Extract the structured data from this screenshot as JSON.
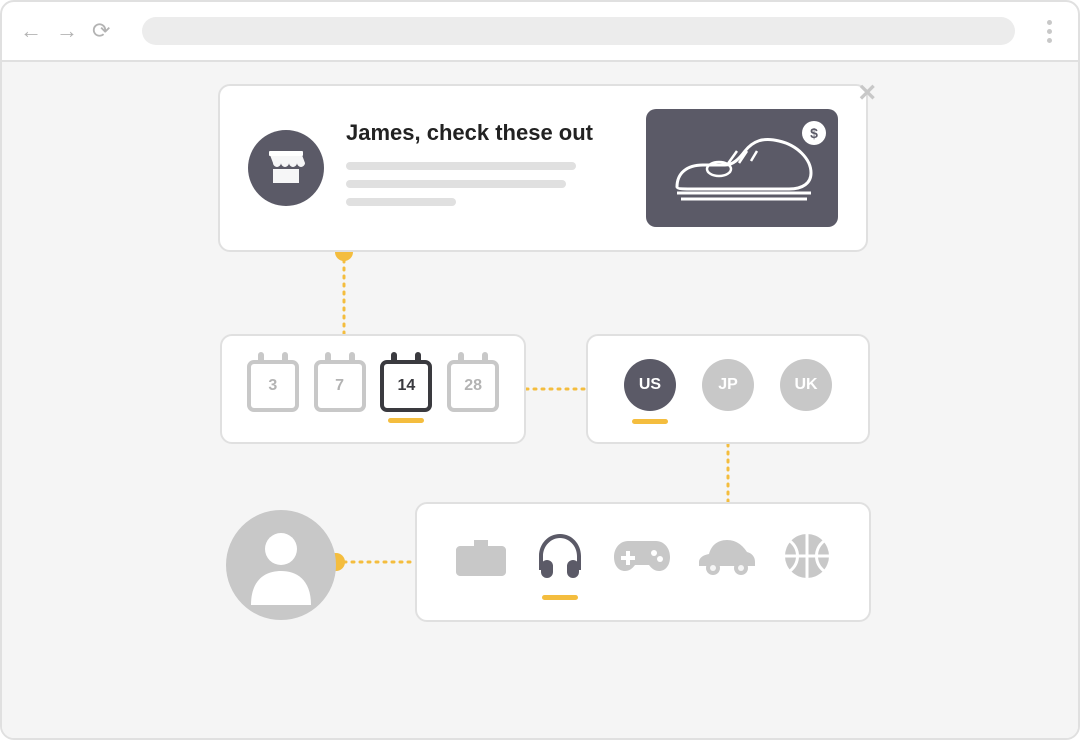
{
  "ad": {
    "headline": "James, check these out",
    "price_symbol": "$"
  },
  "days": [
    {
      "label": "3",
      "active": false
    },
    {
      "label": "7",
      "active": false
    },
    {
      "label": "14",
      "active": true
    },
    {
      "label": "28",
      "active": false
    }
  ],
  "regions": [
    {
      "code": "US",
      "active": true
    },
    {
      "code": "JP",
      "active": false
    },
    {
      "code": "UK",
      "active": false
    }
  ],
  "interests": [
    {
      "name": "briefcase-icon",
      "active": false
    },
    {
      "name": "headphones-icon",
      "active": true
    },
    {
      "name": "gamepad-icon",
      "active": false
    },
    {
      "name": "car-icon",
      "active": false
    },
    {
      "name": "basketball-icon",
      "active": false
    }
  ]
}
